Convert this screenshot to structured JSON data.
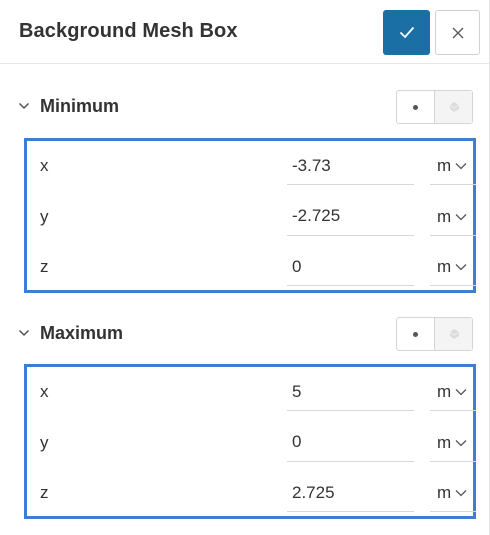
{
  "header": {
    "title": "Background Mesh Box",
    "confirm_icon": "check-icon",
    "close_icon": "close-icon",
    "accent": "#1a6fa5"
  },
  "minimum": {
    "title": "Minimum",
    "rows": [
      {
        "axis": "x",
        "value": "-3.73",
        "unit": "m"
      },
      {
        "axis": "y",
        "value": "-2.725",
        "unit": "m"
      },
      {
        "axis": "z",
        "value": "0",
        "unit": "m"
      }
    ]
  },
  "maximum": {
    "title": "Maximum",
    "rows": [
      {
        "axis": "x",
        "value": "5",
        "unit": "m"
      },
      {
        "axis": "y",
        "value": "0",
        "unit": "m"
      },
      {
        "axis": "z",
        "value": "2.725",
        "unit": "m"
      }
    ]
  },
  "highlight_color": "#3d7dd6"
}
